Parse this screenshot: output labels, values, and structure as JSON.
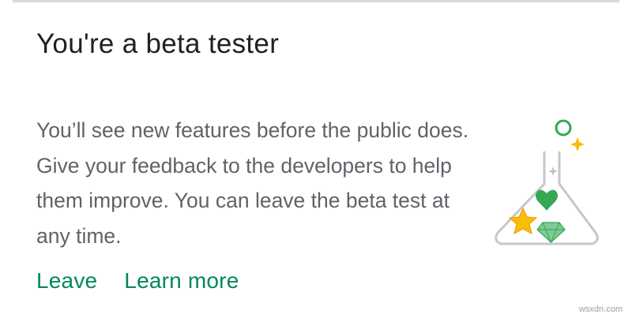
{
  "card": {
    "title": "You're a beta tester",
    "description": "You’ll see new features before the public does. Give your feedback to the developers to help them improve. You can leave the beta test at any time.",
    "actions": {
      "leave_label": "Leave",
      "learn_more_label": "Learn more"
    }
  },
  "illustration": {
    "icon": "beta-flask-icon",
    "elements": [
      "green-ring",
      "yellow-sparkle",
      "grey-sparkle",
      "green-heart",
      "yellow-star",
      "green-gem"
    ]
  },
  "watermark": "wsxdn.com",
  "colors": {
    "accent": "#01875f",
    "title": "#202124",
    "body": "#5f6368",
    "divider": "#d9d9d9",
    "heart": "#34a853",
    "star": "#fbbc04",
    "gem": "#81c995"
  }
}
